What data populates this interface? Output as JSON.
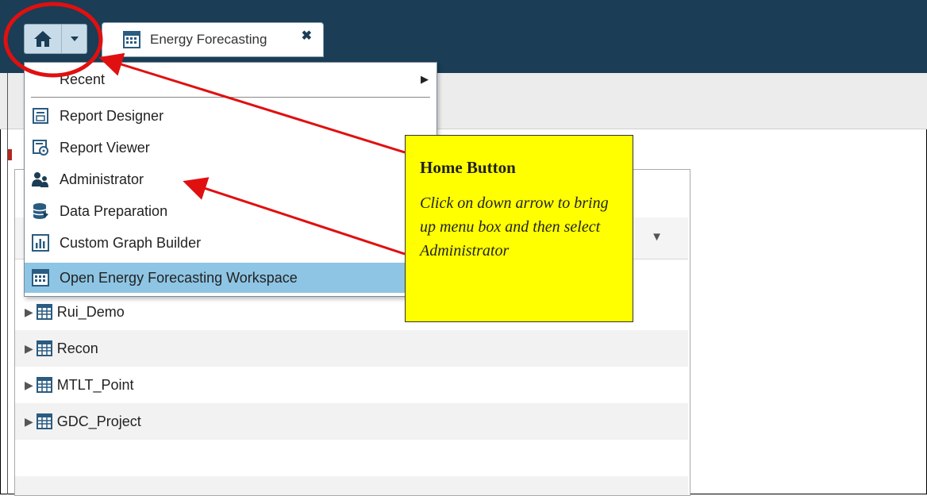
{
  "colors": {
    "topbar": "#1b3d55",
    "menu_selected": "#8ec5e4",
    "callout_bg": "#ffff00",
    "annotation_red": "#e01010"
  },
  "tab": {
    "label": "Energy Forecasting",
    "close_icon": "x-icon"
  },
  "home": {
    "icon": "home-icon",
    "dropdown_icon": "chevron-down-icon"
  },
  "menu": {
    "items": [
      {
        "label": "Recent",
        "icon": "",
        "submenu": true
      },
      {
        "label": "Report Designer",
        "icon": "report-designer-icon"
      },
      {
        "label": "Report Viewer",
        "icon": "report-viewer-icon"
      },
      {
        "label": "Administrator",
        "icon": "admin-users-icon"
      },
      {
        "label": "Data Preparation",
        "icon": "data-prep-icon"
      },
      {
        "label": "Custom Graph Builder",
        "icon": "graph-builder-icon"
      },
      {
        "label": "Open Energy Forecasting Workspace",
        "icon": "workspace-icon",
        "selected": true
      }
    ]
  },
  "tree": {
    "items": [
      {
        "label": "Rui_Demo"
      },
      {
        "label": "Recon"
      },
      {
        "label": "MTLT_Point"
      },
      {
        "label": "GDC_Project"
      }
    ]
  },
  "callout": {
    "title": "Home Button",
    "body": "Click on down arrow to bring up menu box and then select Administrator"
  }
}
